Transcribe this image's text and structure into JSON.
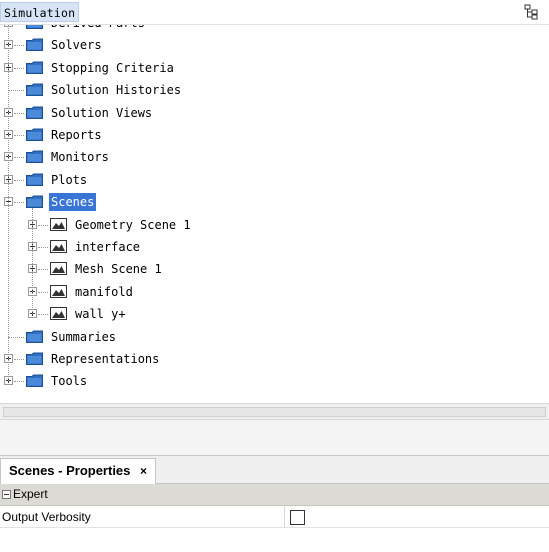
{
  "header": {
    "title": "Simulation",
    "icon": "tree-view-icon"
  },
  "tree": {
    "items": [
      {
        "label": "Derived Parts",
        "type": "folder",
        "expandable": true
      },
      {
        "label": "Solvers",
        "type": "folder",
        "expandable": true
      },
      {
        "label": "Stopping Criteria",
        "type": "folder",
        "expandable": true
      },
      {
        "label": "Solution Histories",
        "type": "folder",
        "expandable": false
      },
      {
        "label": "Solution Views",
        "type": "folder",
        "expandable": true
      },
      {
        "label": "Reports",
        "type": "folder",
        "expandable": true
      },
      {
        "label": "Monitors",
        "type": "folder",
        "expandable": true
      },
      {
        "label": "Plots",
        "type": "folder",
        "expandable": true
      },
      {
        "label": "Scenes",
        "type": "folder",
        "expanded": true,
        "selected": true
      },
      {
        "label": "Geometry Scene 1",
        "type": "scene",
        "expandable": true
      },
      {
        "label": "interface",
        "type": "scene",
        "expandable": true
      },
      {
        "label": "Mesh Scene 1",
        "type": "scene",
        "expandable": true
      },
      {
        "label": "manifold",
        "type": "scene",
        "expandable": true
      },
      {
        "label": "wall y+",
        "type": "scene",
        "expandable": true
      },
      {
        "label": "Summaries",
        "type": "folder",
        "expandable": false
      },
      {
        "label": "Representations",
        "type": "folder",
        "expandable": true
      },
      {
        "label": "Tools",
        "type": "folder",
        "expandable": true
      }
    ],
    "colors": {
      "selection": "#3875d7",
      "folder": "#2f6fc4"
    }
  },
  "properties": {
    "tab_label": "Scenes - Properties",
    "tab_close": "×",
    "section_label": "Expert",
    "rows": [
      {
        "name": "Output Verbosity",
        "checked": false
      }
    ]
  }
}
